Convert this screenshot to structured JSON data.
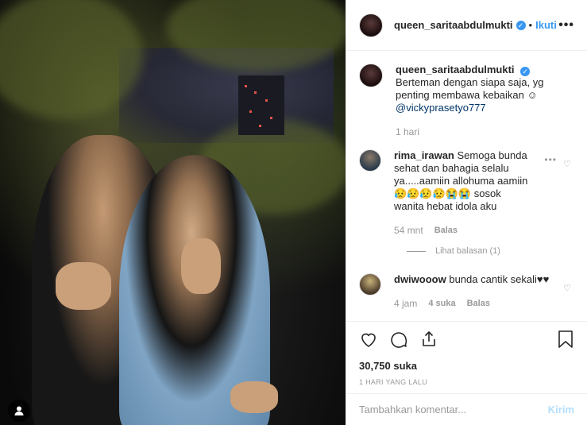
{
  "post": {
    "username": "queen_saritaabdulmukti",
    "separator": "•",
    "follow_label": "Ikuti",
    "more_label": "•••"
  },
  "caption": {
    "username": "queen_saritaabdulmukti",
    "text": "Berteman dengan siapa saja, yg penting membawa kebaikan ☺",
    "mention": "@vickyprasetyo777",
    "time": "1 hari"
  },
  "comments": [
    {
      "username": "rima_irawan",
      "text": "Semoga bunda sehat dan bahagia selalu ya.....aamiin allohuma aamiin 😥😥😥😥😭😭 sosok wanita hebat idola aku",
      "time": "54 mnt",
      "likes": "",
      "reply_label": "Balas",
      "view_replies": "Lihat balasan (1)"
    },
    {
      "username": "dwiwooow",
      "text": "bunda cantik sekali♥♥",
      "time": "4 jam",
      "likes": "4 suka",
      "reply_label": "Balas"
    }
  ],
  "stats": {
    "likes": "30,750 suka",
    "posted": "1 HARI YANG LALU"
  },
  "compose": {
    "placeholder": "Tambahkan komentar...",
    "post_label": "Kirim"
  },
  "colors": {
    "link": "#3897f0",
    "mention": "#003569",
    "muted": "#999999",
    "post_disabled": "#b2dffc"
  }
}
